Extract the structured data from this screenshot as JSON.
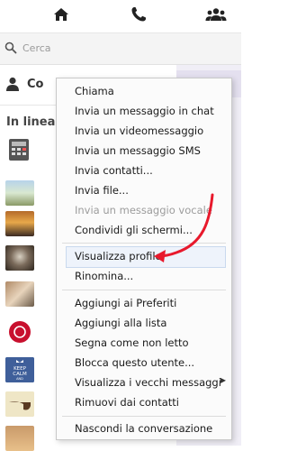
{
  "search": {
    "placeholder": "Cerca"
  },
  "contacts_header": {
    "label": "Co"
  },
  "online": {
    "label": "In linea"
  },
  "context_menu": {
    "items": [
      {
        "label": "Chiama",
        "enabled": true
      },
      {
        "label": "Invia un messaggio in chat",
        "enabled": true
      },
      {
        "label": "Invia un videomessaggio",
        "enabled": true
      },
      {
        "label": "Invia un messaggio SMS",
        "enabled": true
      },
      {
        "label": "Invia contatti...",
        "enabled": true
      },
      {
        "label": "Invia file...",
        "enabled": true
      },
      {
        "label": "Invia un messaggio vocale",
        "enabled": false
      },
      {
        "label": "Condividi gli schermi...",
        "enabled": true
      },
      {
        "label": "Visualizza profilo",
        "enabled": true,
        "highlighted": true
      },
      {
        "label": "Rinomina...",
        "enabled": true
      },
      {
        "label": "Aggiungi ai Preferiti",
        "enabled": true
      },
      {
        "label": "Aggiungi alla lista",
        "enabled": true
      },
      {
        "label": "Segna come non letto",
        "enabled": true
      },
      {
        "label": "Blocca questo utente...",
        "enabled": true
      },
      {
        "label": "Visualizza i vecchi messaggi",
        "enabled": true,
        "submenu": true
      },
      {
        "label": "Rimuovi dai contatti",
        "enabled": true
      },
      {
        "label": "Nascondi la conversazione",
        "enabled": true
      }
    ]
  },
  "icons": {
    "nav": [
      "home-icon",
      "phone-icon",
      "group-icon"
    ],
    "search": "search-icon",
    "contacts": "user-icon",
    "submenu": "triangle-right-icon"
  },
  "colors": {
    "annotation_arrow": "#e8192c",
    "highlight": "#eef3fb",
    "disabled_text": "#9c9c9c"
  }
}
